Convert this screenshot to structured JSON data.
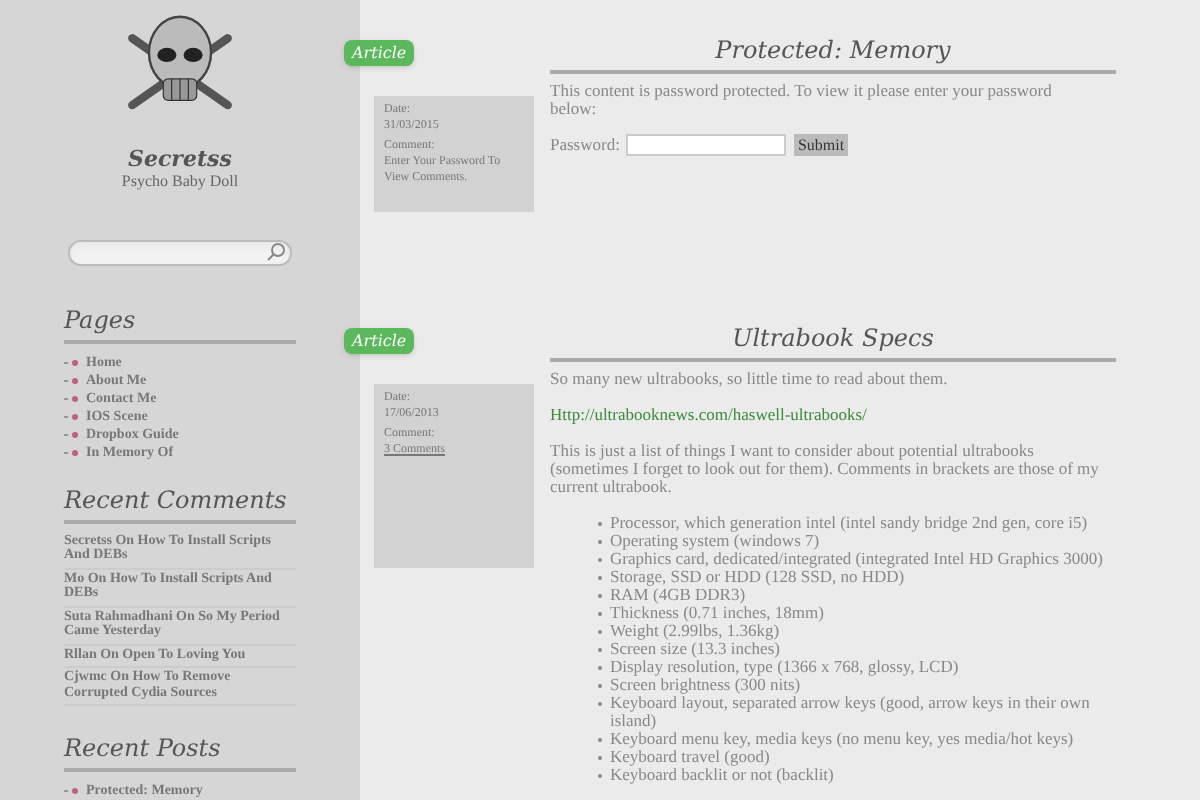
{
  "site": {
    "title": "Secretss",
    "tagline": "Psycho Baby Doll"
  },
  "sidebar": [
    {
      "heading": "Pages",
      "kind": "bullets",
      "items": [
        "Home",
        "About Me",
        "Contact Me",
        "IOS Scene",
        "Dropbox Guide",
        "In Memory Of"
      ]
    },
    {
      "heading": "Recent Comments",
      "kind": "plain",
      "items": [
        "Secretss On How To Install Scripts And DEBs",
        "Mo On How To Install Scripts And DEBs",
        "Suta Rahmadhani On So My Period Came Yesterday",
        "Rllan On Open To Loving You",
        "Cjwmc On How To Remove Corrupted Cydia Sources"
      ]
    },
    {
      "heading": "Recent Posts",
      "kind": "bullets",
      "items": [
        "Protected: Memory"
      ]
    }
  ],
  "posts": [
    {
      "ribbon": "Article",
      "title": "Protected: Memory",
      "date_label": "Date:",
      "date": "31/03/2015",
      "comment_label": "Comment:",
      "comments": "Enter Your Password To View Comments.",
      "comments_link": false,
      "intro": "This content is password protected. To view it please enter your password below:",
      "password_label": "Password:",
      "submit": "Submit"
    },
    {
      "ribbon": "Article",
      "title": "Ultrabook Specs",
      "date_label": "Date:",
      "date": "17/06/2013",
      "comment_label": "Comment:",
      "comments": "3 Comments",
      "comments_link": true,
      "intro": "So many new ultrabooks, so little time to read about them.",
      "link": "Http://ultrabooknews.com/haswell-ultrabooks/",
      "paragraph": "This is just a list of things I want to consider about potential ultrabooks (sometimes I forget to look out for them). Comments in brackets are those of my current ultrabook.",
      "list": [
        "Processor, which generation intel (intel sandy bridge 2nd gen, core i5)",
        "Operating system (windows 7)",
        "Graphics card, dedicated/integrated (integrated Intel HD Graphics 3000)",
        "Storage, SSD or HDD (128 SSD, no HDD)",
        "RAM (4GB DDR3)",
        "Thickness (0.71 inches, 18mm)",
        "Weight (2.99lbs, 1.36kg)",
        "Screen size (13.3 inches)",
        "Display resolution, type (1366 x 768, glossy, LCD)",
        "Screen brightness (300 nits)",
        "Keyboard layout, separated arrow keys (good, arrow keys in their own island)",
        "Keyboard menu key, media keys (no menu key, yes media/hot keys)",
        "Keyboard travel (good)",
        "Keyboard backlit or not (backlit)"
      ]
    }
  ]
}
